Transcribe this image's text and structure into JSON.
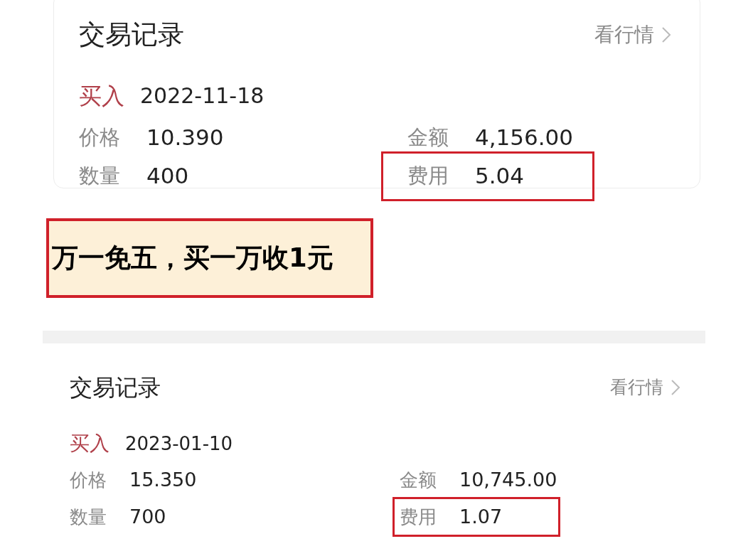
{
  "records": [
    {
      "title": "交易记录",
      "link": "看行情",
      "side": "买入",
      "date": "2022-11-18",
      "fields": [
        {
          "label": "价格",
          "value": "10.390",
          "highlighted": false
        },
        {
          "label": "金额",
          "value": "4,156.00",
          "highlighted": false
        },
        {
          "label": "数量",
          "value": "400",
          "highlighted": false
        },
        {
          "label": "费用",
          "value": "5.04",
          "highlighted": true
        }
      ]
    },
    {
      "title": "交易记录",
      "link": "看行情",
      "side": "买入",
      "date": "2023-01-10",
      "fields": [
        {
          "label": "价格",
          "value": "15.350",
          "highlighted": false
        },
        {
          "label": "金额",
          "value": "10,745.00",
          "highlighted": false
        },
        {
          "label": "数量",
          "value": "700",
          "highlighted": false
        },
        {
          "label": "费用",
          "value": "1.07",
          "highlighted": true
        }
      ]
    }
  ],
  "annotation": "万一免五，买一万收1元"
}
